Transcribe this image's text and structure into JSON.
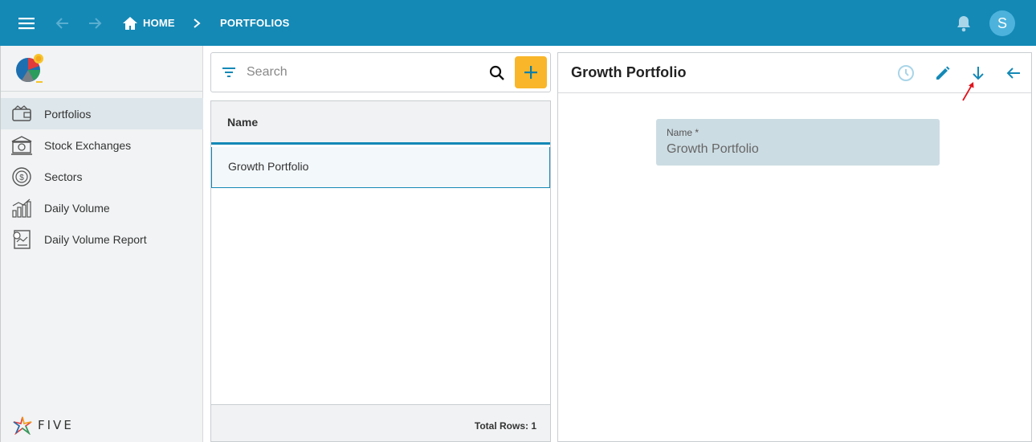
{
  "topbar": {
    "home_label": "HOME",
    "section_label": "PORTFOLIOS",
    "avatar_initial": "S",
    "colors": {
      "bar": "#1489b6",
      "avatar": "#4db3dc"
    }
  },
  "sidebar": {
    "items": [
      {
        "label": "Portfolios",
        "icon": "wallet-icon",
        "active": true
      },
      {
        "label": "Stock Exchanges",
        "icon": "bank-icon",
        "active": false
      },
      {
        "label": "Sectors",
        "icon": "dollar-circle-icon",
        "active": false
      },
      {
        "label": "Daily Volume",
        "icon": "bar-chart-icon",
        "active": false
      },
      {
        "label": "Daily Volume Report",
        "icon": "report-icon",
        "active": false
      }
    ],
    "brand": "FIVE"
  },
  "list": {
    "search_placeholder": "Search",
    "column_header": "Name",
    "rows": [
      {
        "name": "Growth Portfolio",
        "selected": true
      }
    ],
    "footer": "Total Rows: 1"
  },
  "detail": {
    "title": "Growth Portfolio",
    "fields": [
      {
        "label": "Name *",
        "value": "Growth Portfolio"
      }
    ]
  },
  "colors": {
    "accent": "#1489b6",
    "add_button": "#f9b62a",
    "field_bg": "#ccdce3"
  }
}
